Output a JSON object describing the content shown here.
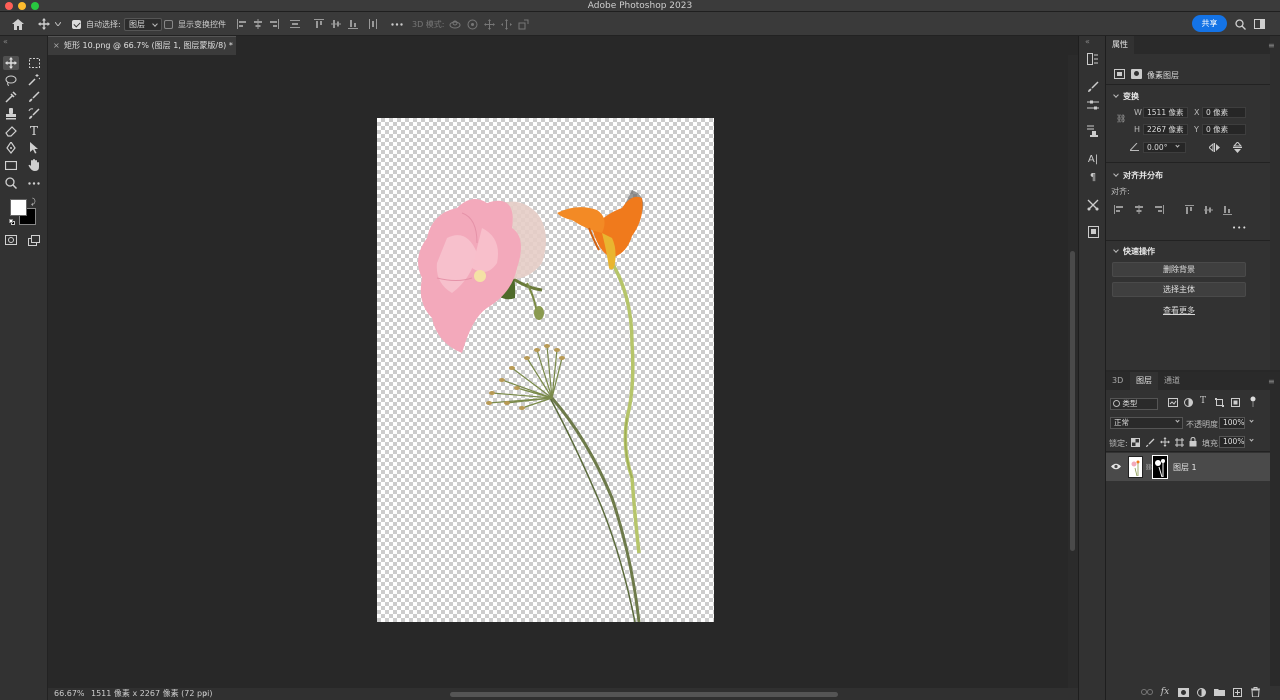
{
  "app": {
    "title": "Adobe Photoshop 2023"
  },
  "options_bar": {
    "auto_select_label": "自动选择:",
    "auto_select_value": "图层",
    "show_transform_label": "显示变换控件",
    "mode_3d_label": "3D 模式:",
    "share_label": "共享"
  },
  "document": {
    "tab_title": "矩形 10.png @ 66.7% (图层 1, 图层蒙版/8) *",
    "tab_close": "×"
  },
  "status": {
    "zoom": "66.67%",
    "doc_size": "1511 像素 x 2267 像素 (72 ppi)",
    "arrow": "›"
  },
  "properties": {
    "tab_label": "属性",
    "layer_kind": "像素图层",
    "transform": {
      "title": "变换",
      "w_label": "W",
      "w_value": "1511 像素",
      "x_label": "X",
      "x_value": "0 像素",
      "h_label": "H",
      "h_value": "2267 像素",
      "y_label": "Y",
      "y_value": "0 像素",
      "angle_value": "0.00°"
    },
    "align": {
      "title": "对齐并分布",
      "label": "对齐:",
      "more": "•••"
    },
    "quick_actions": {
      "title": "快速操作",
      "remove_bg": "删除背景",
      "select_subject": "选择主体",
      "see_more": "查看更多"
    }
  },
  "layers_panel": {
    "tabs": [
      "3D",
      "图层",
      "通道"
    ],
    "filter_label": "类型",
    "blend_mode": "正常",
    "opacity_label": "不透明度:",
    "opacity_value": "100%",
    "lock_label": "锁定:",
    "fill_label": "填充:",
    "fill_value": "100%",
    "layers": [
      {
        "name": "图层 1",
        "visible": true
      }
    ]
  }
}
